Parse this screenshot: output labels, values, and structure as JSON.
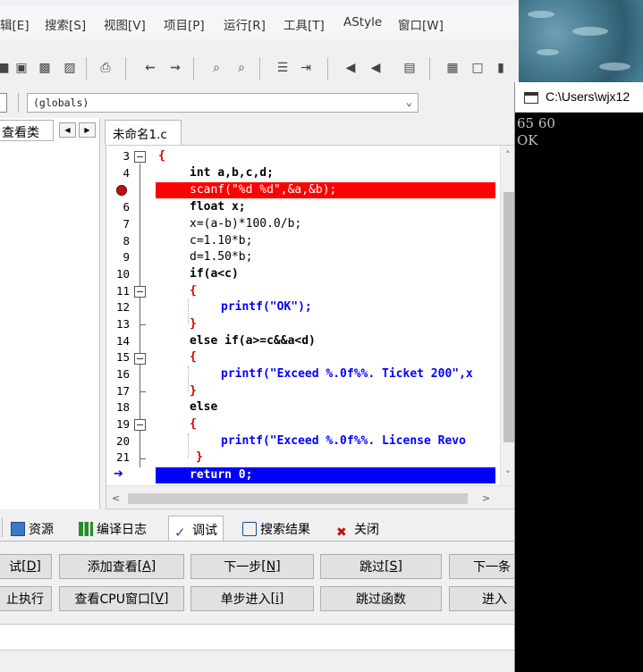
{
  "menu": {
    "items": [
      "辑[E]",
      "搜索[S]",
      "视图[V]",
      "项目[P]",
      "运行[R]",
      "工具[T]",
      "AStyle",
      "窗口[W]"
    ]
  },
  "scope": {
    "value": "(globals)"
  },
  "left_panel": {
    "tab_label": "查看类"
  },
  "editor": {
    "tab_label": "未命名1.c",
    "lines": [
      {
        "num": "3",
        "text": "{"
      },
      {
        "num": "4",
        "text": "int a,b,c,d;"
      },
      {
        "num": "5",
        "text": "scanf(\"%d %d\",&a,&b);"
      },
      {
        "num": "6",
        "text": "float x;"
      },
      {
        "num": "7",
        "text": "x=(a-b)*100.0/b;"
      },
      {
        "num": "8",
        "text": "c=1.10*b;"
      },
      {
        "num": "9",
        "text": "d=1.50*b;"
      },
      {
        "num": "10",
        "text": "if(a<c)"
      },
      {
        "num": "11",
        "text": "{"
      },
      {
        "num": "12",
        "text": "printf(\"OK\");"
      },
      {
        "num": "13",
        "text": "}"
      },
      {
        "num": "14",
        "text": "else if(a>=c&&a<d)"
      },
      {
        "num": "15",
        "text": "{"
      },
      {
        "num": "16",
        "text": "printf(\"Exceed %.0f%%. Ticket 200\",x"
      },
      {
        "num": "17",
        "text": "}"
      },
      {
        "num": "18",
        "text": "else"
      },
      {
        "num": "19",
        "text": "{"
      },
      {
        "num": "20",
        "text": "printf(\"Exceed %.0f%%. License Revo"
      },
      {
        "num": "21",
        "text": "}"
      },
      {
        "num": "22",
        "text": "return 0;"
      }
    ],
    "breakpoint_line": "5",
    "current_line": "22"
  },
  "bottom_tabs": {
    "resources": "资源",
    "compile_log": "编译日志",
    "debug": "调试",
    "search_results": "搜索结果",
    "close": "关闭"
  },
  "debug_buttons": {
    "row1": [
      {
        "label": "试",
        "key": "[D]"
      },
      {
        "label": "添加查看",
        "key": "[A]"
      },
      {
        "label": "下一步",
        "key": "[N]"
      },
      {
        "label": "跳过",
        "key": "[S]"
      },
      {
        "label": "下一条",
        "key": ""
      }
    ],
    "row2": [
      {
        "label": "止执行",
        "key": ""
      },
      {
        "label": "查看CPU窗口",
        "key": "[V]"
      },
      {
        "label": "单步进入",
        "key": "[i]"
      },
      {
        "label": "跳过函数",
        "key": ""
      },
      {
        "label": "进入",
        "key": ""
      }
    ]
  },
  "console": {
    "title": "C:\\Users\\wjx12",
    "output": [
      "65 60",
      "OK"
    ]
  },
  "colors": {
    "breakpoint": "#ff0000",
    "current_line": "#0000ff",
    "string": "#0000ff",
    "symbol": "#d40000"
  }
}
